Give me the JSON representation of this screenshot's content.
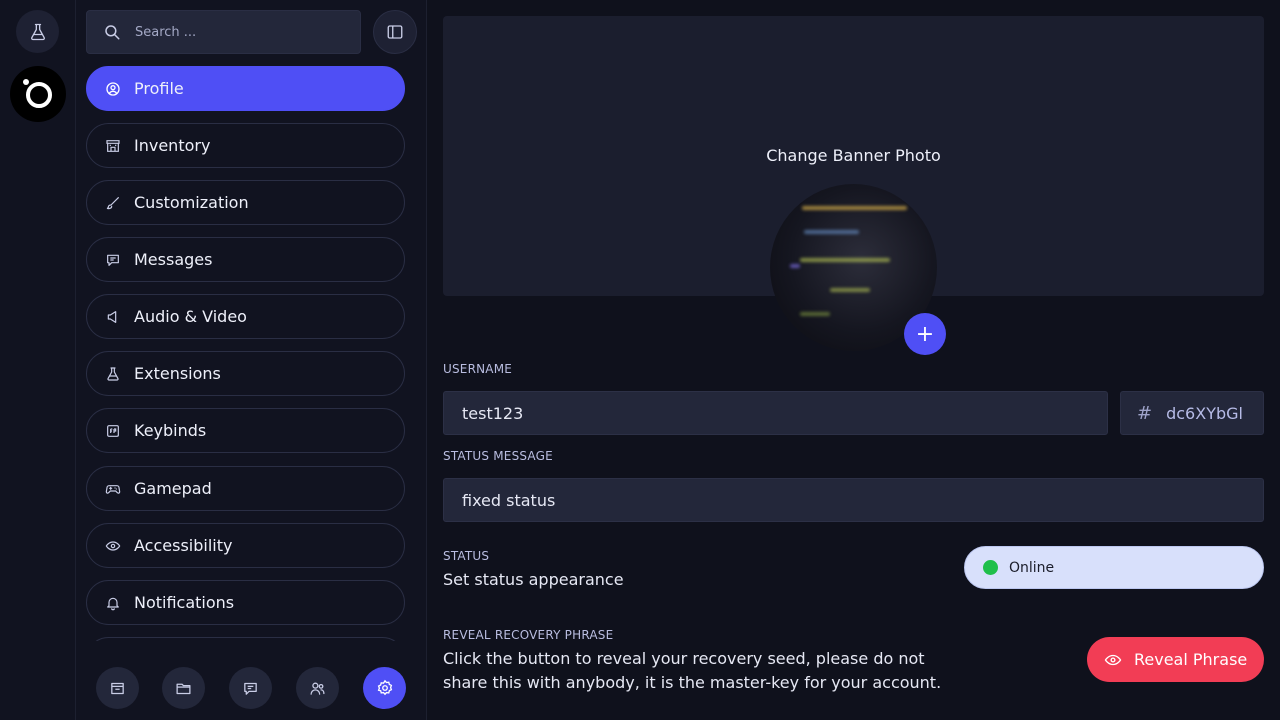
{
  "rail": {
    "top_icon": "flask-icon",
    "logo_icon": "app-logo-icon"
  },
  "search": {
    "placeholder": "Search ..."
  },
  "sidebar": {
    "items": [
      {
        "label": "Profile",
        "icon": "user-circle-icon",
        "active": true
      },
      {
        "label": "Inventory",
        "icon": "store-icon"
      },
      {
        "label": "Customization",
        "icon": "brush-icon"
      },
      {
        "label": "Messages",
        "icon": "message-icon"
      },
      {
        "label": "Audio & Video",
        "icon": "speaker-icon"
      },
      {
        "label": "Extensions",
        "icon": "flask-icon"
      },
      {
        "label": "Keybinds",
        "icon": "keyboard-icon"
      },
      {
        "label": "Gamepad",
        "icon": "gamepad-icon"
      },
      {
        "label": "Accessibility",
        "icon": "eye-icon"
      },
      {
        "label": "Notifications",
        "icon": "bell-icon"
      }
    ]
  },
  "bottom_bar": {
    "buttons": [
      "inbox-icon",
      "folder-icon",
      "chat-icon",
      "users-icon",
      "settings-icon"
    ],
    "active": "settings-icon"
  },
  "profile": {
    "banner_text": "Change Banner Photo",
    "add_symbol": "+",
    "username_label": "USERNAME",
    "username_value": "test123",
    "id_hash": "#",
    "id_value": "dc6XYbGl",
    "status_message_label": "STATUS MESSAGE",
    "status_message_value": "fixed status",
    "status_label": "STATUS",
    "status_desc": "Set status appearance",
    "status_value": "Online",
    "recovery_label": "REVEAL RECOVERY PHRASE",
    "recovery_desc": "Click the button to reveal your recovery seed, please do not share this with anybody, it is the master-key for your account.",
    "reveal_button": "Reveal Phrase"
  },
  "colors": {
    "accent": "#4f4ff5",
    "danger": "#f23d55",
    "online": "#1fbf4a"
  }
}
